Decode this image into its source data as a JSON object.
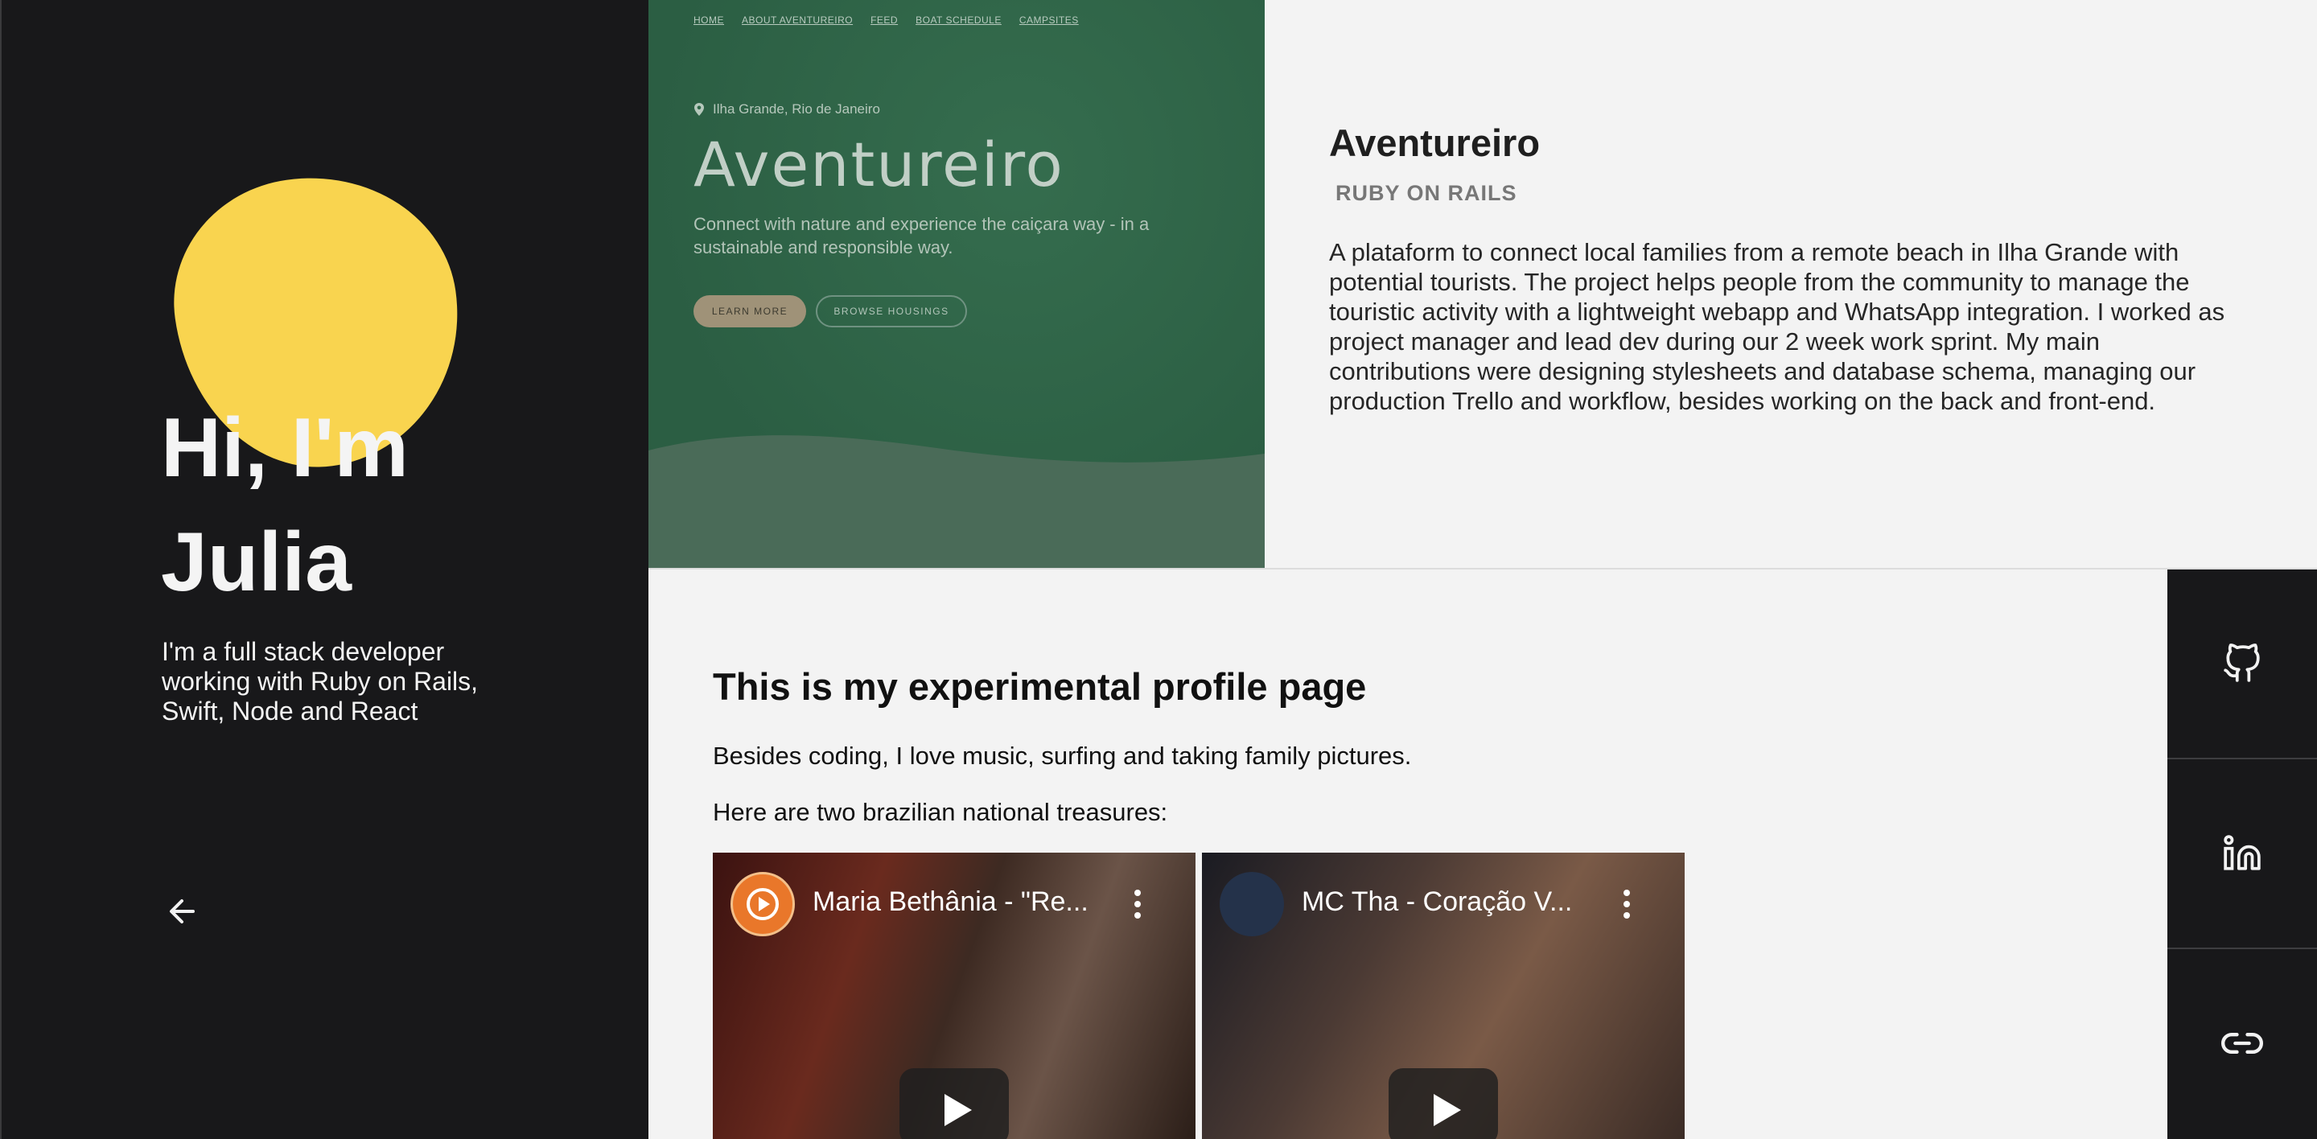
{
  "profile": {
    "greeting_line1": "Hi, I'm",
    "greeting_line2": "Julia",
    "bio": "I'm a full stack developer working with Ruby on Rails, Swift, Node and React",
    "back_icon": "arrow-left-icon",
    "blob_color": "#f9d44f"
  },
  "project_screenshot": {
    "nav": [
      "HOME",
      "ABOUT AVENTUREIRO",
      "FEED",
      "BOAT SCHEDULE",
      "CAMPSITES"
    ],
    "location": "Ilha Grande, Rio de Janeiro",
    "title": "Aventureiro",
    "subtitle": "Connect with nature and experience the caiçara way - in a sustainable and responsible way.",
    "button_primary": "LEARN MORE",
    "button_secondary": "BROWSE HOUSINGS"
  },
  "project": {
    "title": "Aventureiro",
    "tag": "RUBY ON RAILS",
    "description": "A plataform to connect local families from a remote beach in Ilha Grande with potential tourists. The project helps people from the community to manage the touristic activity with a lightweight webapp and WhatsApp integration. I worked as project manager and lead dev during our 2 week work sprint. My main contributions were designing stylesheets and database schema, managing our production Trello and workflow, besides working on the back and front-end."
  },
  "experimental": {
    "title": "This is my experimental profile page",
    "paragraph1": "Besides coding, I love music, surfing and taking family pictures.",
    "paragraph2": "Here are two brazilian national treasures:",
    "videos": [
      {
        "title": "Maria Bethânia - \"Re..."
      },
      {
        "title": "MC Tha - Coração V..."
      }
    ]
  },
  "social": {
    "items": [
      {
        "icon": "github-icon"
      },
      {
        "icon": "linkedin-icon"
      },
      {
        "icon": "link-icon"
      }
    ]
  },
  "colors": {
    "dark": "#18181a",
    "accent": "#f9d44f",
    "screenshot_green": "#2f6648",
    "light_bg": "#f3f3f3"
  }
}
